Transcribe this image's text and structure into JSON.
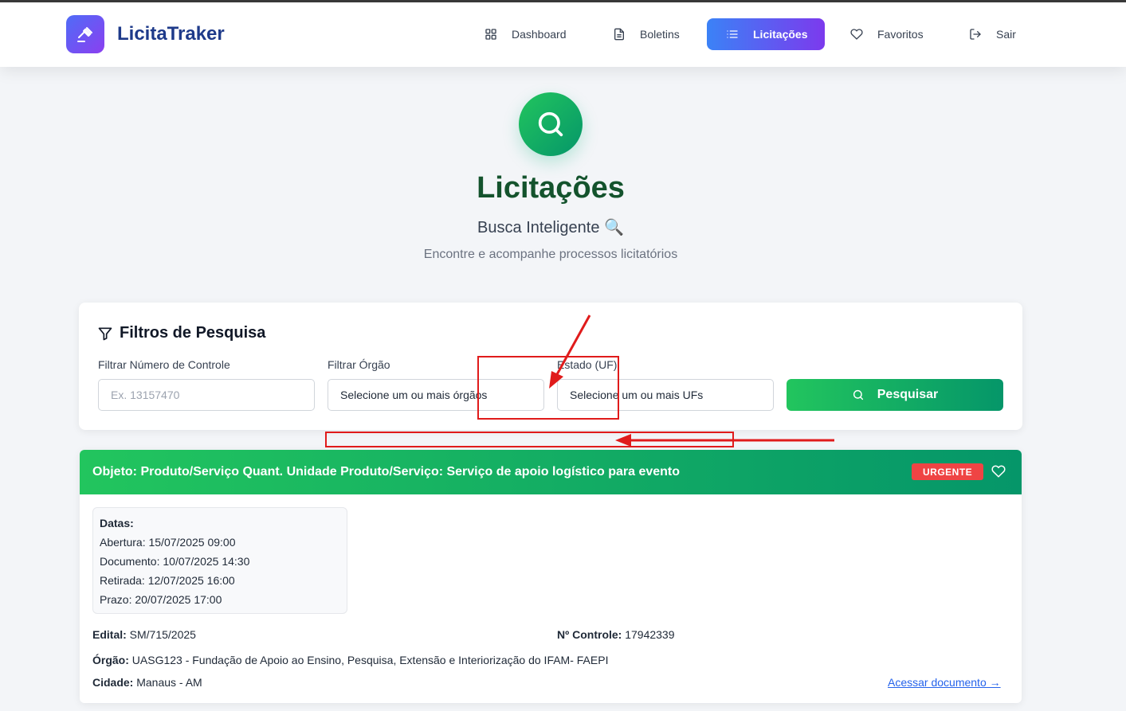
{
  "brand": {
    "name": "LicitaTraker",
    "icon": "gavel-icon"
  },
  "nav": {
    "items": [
      {
        "label": "Dashboard",
        "icon": "grid-icon",
        "active": false
      },
      {
        "label": "Boletins",
        "icon": "document-icon",
        "active": false
      },
      {
        "label": "Licitações",
        "icon": "list-icon",
        "active": true
      },
      {
        "label": "Favoritos",
        "icon": "heart-icon",
        "active": false
      },
      {
        "label": "Sair",
        "icon": "logout-icon",
        "active": false
      }
    ]
  },
  "hero": {
    "icon": "search-icon",
    "title": "Licitações",
    "subtitle": "Busca Inteligente 🔍",
    "description": "Encontre e acompanhe processos licitatórios"
  },
  "filters": {
    "title": "Filtros de Pesquisa",
    "control_number": {
      "label": "Filtrar Número de Controle",
      "placeholder": "Ex. 13157470"
    },
    "organ": {
      "label": "Filtrar Órgão",
      "value": "Selecione um ou mais órgãos"
    },
    "state": {
      "label": "Estado (UF)",
      "value": "Selecione um ou mais UFs"
    },
    "search_button": "Pesquisar"
  },
  "result": {
    "title": "Objeto: Produto/Serviço Quant. Unidade Produto/Serviço: Serviço de apoio logístico para evento",
    "badge": "URGENTE",
    "dates": {
      "heading": "Datas:",
      "abertura_label": "Abertura:",
      "abertura": "15/07/2025 09:00",
      "documento_label": "Documento:",
      "documento": "10/07/2025 14:30",
      "retirada_label": "Retirada:",
      "retirada": "12/07/2025 16:00",
      "prazo_label": "Prazo:",
      "prazo": "20/07/2025 17:00"
    },
    "edital_label": "Edital:",
    "edital": "SM/715/2025",
    "controle_label": "Nº Controle:",
    "controle": "17942339",
    "orgao_label": "Órgão:",
    "orgao": "UASG123 - Fundação de Apoio ao Ensino, Pesquisa, Extensão e Interiorização do IFAM- FAEPI",
    "cidade_label": "Cidade:",
    "cidade": "Manaus - AM",
    "link": "Acessar documento →"
  },
  "colors": {
    "brand": "#1e3a8a",
    "accent_green": "#10b981",
    "nav_active_start": "#3b82f6",
    "nav_active_end": "#7c3aed",
    "urgent": "#ef4444",
    "annotation": "#e01b1b"
  }
}
